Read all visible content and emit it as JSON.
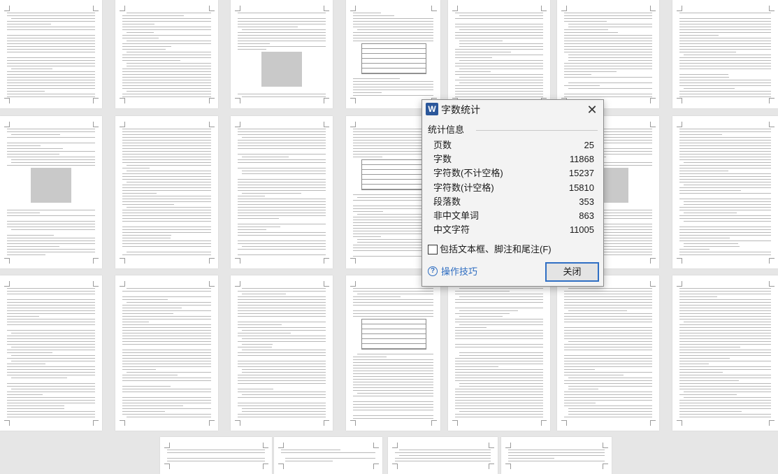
{
  "dialog": {
    "app_icon": "W",
    "title": "字数统计",
    "close_glyph": "✕",
    "section_label": "统计信息",
    "stats": [
      {
        "label": "页数",
        "value": "25"
      },
      {
        "label": "字数",
        "value": "11868"
      },
      {
        "label": "字符数(不计空格)",
        "value": "15237"
      },
      {
        "label": "字符数(计空格)",
        "value": "15810"
      },
      {
        "label": "段落数",
        "value": "353"
      },
      {
        "label": "非中文单词",
        "value": "863"
      },
      {
        "label": "中文字符",
        "value": "11005"
      }
    ],
    "include_checkbox_label": "包括文本框、脚注和尾注(F)",
    "include_checked": false,
    "tips_label": "操作技巧",
    "tips_icon": "?",
    "close_button_label": "关闭"
  },
  "icons": {
    "app_icon": "word-app-icon",
    "close": "close-icon",
    "tips": "help-icon"
  },
  "colors": {
    "accent": "#2f6fc4",
    "link": "#2d6cc0",
    "app_icon_bg": "#2b579a"
  }
}
